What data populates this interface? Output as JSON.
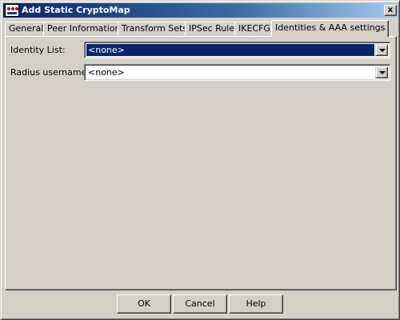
{
  "window": {
    "title": "Add Static CryptoMap",
    "close_label": "x"
  },
  "tabs": [
    {
      "label": "General",
      "active": false
    },
    {
      "label": "Peer Information",
      "active": false
    },
    {
      "label": "Transform Sets",
      "active": false
    },
    {
      "label": "IPSec Rule",
      "active": false
    },
    {
      "label": "IKECFG",
      "active": false
    },
    {
      "label": "Identities & AAA settings",
      "active": true
    }
  ],
  "form": {
    "identity_list": {
      "label": "Identity List:",
      "value": "<none>"
    },
    "radius_username": {
      "label": "Radius username:",
      "value": "<none>"
    }
  },
  "buttons": {
    "ok": "OK",
    "cancel": "Cancel",
    "help": "Help"
  },
  "colors": {
    "title_gradient_start": "#0a246a",
    "title_gradient_end": "#a6caf0",
    "face": "#d4d0c8",
    "selection": "#0a246a"
  },
  "icons": {
    "app": "cryptomap-app-icon",
    "dropdown": "chevron-down-icon"
  }
}
